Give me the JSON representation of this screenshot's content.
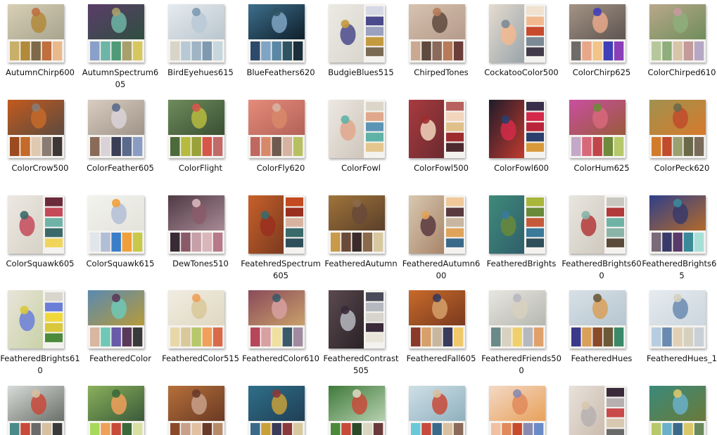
{
  "items": [
    {
      "name": "AutumnChirp600",
      "layout": "bottom",
      "colors": [
        "#c8b06a",
        "#b18a3a",
        "#7e6a4b",
        "#c06f3f",
        "#e9b98c"
      ],
      "bg": [
        "#d8cfb5",
        "#a8a48f"
      ],
      "icon": "bird-icon"
    },
    {
      "name": "AutumnSpectrum605",
      "layout": "bottom",
      "colors": [
        "#8aa0c8",
        "#6db5a6",
        "#4f9b78",
        "#a8a06c",
        "#d6c85f"
      ],
      "bg": [
        "#5b3d6a",
        "#2f4f3f"
      ],
      "icon": "leaf-icon"
    },
    {
      "name": "BirdEyehues615",
      "layout": "bottom",
      "colors": [
        "#d8d4c8",
        "#b8c9d6",
        "#9fb4c4",
        "#7e9ab0",
        "#c6d7de"
      ],
      "bg": [
        "#e6ebee",
        "#b9c6cf"
      ],
      "icon": "eye-icon"
    },
    {
      "name": "BlueFeathers620",
      "layout": "bottom",
      "colors": [
        "#2e4a6b",
        "#7fa4c4",
        "#5a88a4",
        "#2e5464",
        "#1b2f3a"
      ],
      "bg": [
        "#3d6f8c",
        "#0f1f2b"
      ],
      "icon": "feather-icon"
    },
    {
      "name": "BudgieBlues515",
      "layout": "right",
      "colors": [
        "#d6d9e4",
        "#4b4a8c",
        "#9aa0bd",
        "#c39a3f",
        "#7a6a54"
      ],
      "bg": [
        "#eceae3",
        "#d8d6cd"
      ],
      "icon": "bird-icon"
    },
    {
      "name": "ChirpedTones",
      "layout": "bottom",
      "colors": [
        "#caa891",
        "#5f4a3f",
        "#8a6a5b",
        "#b77b59",
        "#6b3e3a"
      ],
      "bg": [
        "#d7c2b0",
        "#b59a8a"
      ],
      "icon": "bird-icon"
    },
    {
      "name": "CockatooColor500",
      "layout": "right",
      "colors": [
        "#f0e2cf",
        "#f2b98f",
        "#c84a2c",
        "#7c8a96",
        "#433b4a"
      ],
      "bg": [
        "#e5dccf",
        "#9aa4aa"
      ],
      "icon": "bird-icon"
    },
    {
      "name": "ColorChirp625",
      "layout": "bottom",
      "colors": [
        "#6f6b68",
        "#e7a88a",
        "#f2c487",
        "#3f3fb8",
        "#8a3fb8"
      ],
      "bg": [
        "#a49486",
        "#5e5550"
      ],
      "icon": "bird-icon"
    },
    {
      "name": "ColorChirped610",
      "layout": "bottom",
      "colors": [
        "#b6c89b",
        "#8eae7b",
        "#d8c4a8",
        "#c49a9a",
        "#b6a8c4"
      ],
      "bg": [
        "#b9a88b",
        "#6f8d5a"
      ],
      "icon": "bird-icon"
    },
    {
      "name": "ColorCrow500",
      "layout": "bottom",
      "colors": [
        "#9c4a1f",
        "#c46a2a",
        "#e0c9b1",
        "#8a7b73",
        "#3e3535"
      ],
      "bg": [
        "#c25a1e",
        "#5d4a3f"
      ],
      "icon": "bird-icon"
    },
    {
      "name": "ColorFeather605",
      "layout": "bottom",
      "colors": [
        "#8a6a58",
        "#d9d3d8",
        "#3a3f55",
        "#5a6a8c",
        "#8a9cc4"
      ],
      "bg": [
        "#d8cdc0",
        "#a09388"
      ],
      "icon": "feather-icon"
    },
    {
      "name": "ColorFlight",
      "layout": "bottom",
      "colors": [
        "#4d6a3a",
        "#b6bb3f",
        "#9aa03a",
        "#d6564a",
        "#c06a6a"
      ],
      "bg": [
        "#6e8c5c",
        "#3a4f33"
      ],
      "icon": "bird-icon"
    },
    {
      "name": "ColorFly620",
      "layout": "bottom",
      "colors": [
        "#c0675f",
        "#d8886a",
        "#6f5a4f",
        "#d6b3a0",
        "#b6c062"
      ],
      "bg": [
        "#e58b7a",
        "#b36258"
      ],
      "icon": "bird-icon"
    },
    {
      "name": "ColorFowl",
      "layout": "right",
      "colors": [
        "#dbd6c8",
        "#e0a78c",
        "#5c94b6",
        "#5fb3a6",
        "#e4c68e"
      ],
      "bg": [
        "#ece8e2",
        "#cfc6bb"
      ],
      "icon": "bird-icon"
    },
    {
      "name": "ColorFowl500",
      "layout": "right",
      "colors": [
        "#b7625e",
        "#f1d5bd",
        "#e0c08a",
        "#9e2c2f",
        "#4d2a2f"
      ],
      "bg": [
        "#a83a3f",
        "#6b2b30"
      ],
      "icon": "bird-icon"
    },
    {
      "name": "ColorFowl600",
      "layout": "right",
      "colors": [
        "#3a2f4a",
        "#d42a4a",
        "#b9243a",
        "#2a3f6b",
        "#d99a3a"
      ],
      "bg": [
        "#1f1c2a",
        "#c13a2f"
      ],
      "icon": "bird-icon"
    },
    {
      "name": "ColorHum625",
      "layout": "bottom",
      "colors": [
        "#c4a8c8",
        "#d7687a",
        "#c1464a",
        "#6e8a3a",
        "#b6c86a"
      ],
      "bg": [
        "#c94fa0",
        "#9a5a3a"
      ],
      "icon": "bird-icon"
    },
    {
      "name": "ColorPeck620",
      "layout": "bottom",
      "colors": [
        "#d27b2b",
        "#c14b2b",
        "#9aa06f",
        "#6a6a4a",
        "#7a6a5a"
      ],
      "bg": [
        "#a0914f",
        "#d67a2b"
      ],
      "icon": "bird-icon"
    },
    {
      "name": "ColorSquawk605",
      "layout": "right",
      "colors": [
        "#6b2b3a",
        "#c44a5a",
        "#6fb3a8",
        "#3a6a6a",
        "#f0d55a"
      ],
      "bg": [
        "#ece8e2",
        "#d7d2c6"
      ],
      "icon": "bird-icon"
    },
    {
      "name": "ColorSquawk615",
      "layout": "bottom",
      "colors": [
        "#e1e6ea",
        "#b2bed6",
        "#3a7ec8",
        "#f0a03a",
        "#c8c84a"
      ],
      "bg": [
        "#f3f3ef",
        "#e3e3da"
      ],
      "icon": "bird-icon"
    },
    {
      "name": "DewTones510",
      "layout": "bottom",
      "colors": [
        "#3a2a35",
        "#8a5a6a",
        "#c6a0a8",
        "#d9b6ba",
        "#b67a8a"
      ],
      "bg": [
        "#4f3a44",
        "#a88a96"
      ],
      "icon": "leaf-icon"
    },
    {
      "name": "FeatehredSpectrum605",
      "layout": "right",
      "colors": [
        "#c44a1f",
        "#9a2f1f",
        "#d8b3a0",
        "#3a6a6a",
        "#2f4f5a"
      ],
      "bg": [
        "#c8602a",
        "#7a3a1f"
      ],
      "icon": "feather-icon"
    },
    {
      "name": "FeatheredAutumn",
      "layout": "bottom",
      "colors": [
        "#c89a4a",
        "#6a4a3a",
        "#3a2a2a",
        "#8a6a4a",
        "#d8c8a0"
      ],
      "bg": [
        "#a0743a",
        "#5a3f2a"
      ],
      "icon": "feather-icon"
    },
    {
      "name": "FeatheredAutumn600",
      "layout": "right",
      "colors": [
        "#f0c89a",
        "#5a3a3f",
        "#c8b6a0",
        "#e0a35a",
        "#3a6a8a"
      ],
      "bg": [
        "#d8c8b0",
        "#a8856a"
      ],
      "icon": "bird-icon"
    },
    {
      "name": "FeatheredBrights",
      "layout": "right",
      "colors": [
        "#a8b63a",
        "#6a8a3a",
        "#c45a3a",
        "#3a7a9a",
        "#2f4f5a"
      ],
      "bg": [
        "#3f8a7a",
        "#2f5f6a"
      ],
      "icon": "feather-icon"
    },
    {
      "name": "FeatheredBrights600",
      "layout": "right",
      "colors": [
        "#c8c8c0",
        "#b33a3a",
        "#6fb3a6",
        "#8ab4a8",
        "#5a4a3a"
      ],
      "bg": [
        "#e8e6e0",
        "#cfc9be"
      ],
      "icon": "bird-icon"
    },
    {
      "name": "FeatheredBrights605",
      "layout": "bottom",
      "colors": [
        "#7a6a7a",
        "#3a3a6a",
        "#5a3a6a",
        "#3a8a9a",
        "#a8e0d8"
      ],
      "bg": [
        "#2f3f8a",
        "#b36a2a"
      ],
      "icon": "feather-icon"
    },
    {
      "name": "FeatheredBrights610",
      "layout": "right",
      "colors": [
        "#d8d6cc",
        "#6a7ed8",
        "#f0d83a",
        "#d8c83a",
        "#4a8a3a"
      ],
      "bg": [
        "#e8e4da",
        "#c9d2a6"
      ],
      "icon": "bird-icon"
    },
    {
      "name": "FeatheredColor",
      "layout": "bottom",
      "colors": [
        "#d8b6a0",
        "#6fc8b6",
        "#6a5aa8",
        "#5a3a5a",
        "#3a3a3a"
      ],
      "bg": [
        "#5a8ab0",
        "#b69a3a"
      ],
      "icon": "feather-icon"
    },
    {
      "name": "FeatheredColor515",
      "layout": "bottom",
      "colors": [
        "#e8d8a8",
        "#d8c89a",
        "#b6c86a",
        "#f0a05a",
        "#d86a4a"
      ],
      "bg": [
        "#f0ece2",
        "#e0d8c0"
      ],
      "icon": "bird-icon"
    },
    {
      "name": "FeatheredColor610",
      "layout": "bottom",
      "colors": [
        "#b6465a",
        "#d8a0a0",
        "#f0e0a0",
        "#3a5a6a",
        "#a08aa0"
      ],
      "bg": [
        "#8a4a5a",
        "#c9a06a"
      ],
      "icon": "feather-icon"
    },
    {
      "name": "FeatheredContrast505",
      "layout": "right",
      "colors": [
        "#4a4a5a",
        "#b6b8c0",
        "#d6d4cc",
        "#3a2a3a",
        "#e8e4da"
      ],
      "bg": [
        "#5a4a50",
        "#2a2226"
      ],
      "icon": "feather-icon"
    },
    {
      "name": "FeatheredFall605",
      "layout": "bottom",
      "colors": [
        "#8a3a2a",
        "#d6a06a",
        "#c8b6a0",
        "#3a3a5a",
        "#f0c86a"
      ],
      "bg": [
        "#c86a2a",
        "#7a3a1f"
      ],
      "icon": "feather-icon"
    },
    {
      "name": "FeatheredFriends500",
      "layout": "bottom",
      "colors": [
        "#6a8a8a",
        "#d8d0c0",
        "#f0d06a",
        "#b6b8c0",
        "#e0a06a"
      ],
      "bg": [
        "#e8e6e0",
        "#b6b8b0"
      ],
      "icon": "bird-icon"
    },
    {
      "name": "FeatheredHues",
      "layout": "bottom",
      "colors": [
        "#3a3a8a",
        "#d8a05a",
        "#8a4a2a",
        "#6a5a3a",
        "#3a8a6a"
      ],
      "bg": [
        "#d8e0e6",
        "#b6c6d0"
      ],
      "icon": "bird-icon"
    },
    {
      "name": "FeatheredHues_1",
      "layout": "bottom",
      "colors": [
        "#b6cce0",
        "#6a8ab0",
        "#e0d0b6",
        "#d6d0c0",
        "#c8d0d8"
      ],
      "bg": [
        "#e6ebef",
        "#cbd6de"
      ],
      "icon": "bird-icon"
    },
    {
      "name": "",
      "layout": "bottom",
      "colors": [
        "#4a8a8a",
        "#c84a3a",
        "#6a6a6a",
        "#d6c0a0",
        "#3a3a3a"
      ],
      "bg": [
        "#d8dcd8",
        "#6a6f6a"
      ],
      "icon": "bird-icon"
    },
    {
      "name": "",
      "layout": "bottom",
      "colors": [
        "#a8d85a",
        "#f0a05a",
        "#c84a3a",
        "#3a6a3a",
        "#d8e0a0"
      ],
      "bg": [
        "#8ab05a",
        "#3a5a3a"
      ],
      "icon": "bird-icon"
    },
    {
      "name": "",
      "layout": "bottom",
      "colors": [
        "#8a4a2a",
        "#c8a08a",
        "#e0c0a0",
        "#6a3a2a",
        "#b68a6a"
      ],
      "bg": [
        "#b6703a",
        "#6a3a24"
      ],
      "icon": "feather-icon"
    },
    {
      "name": "",
      "layout": "bottom",
      "colors": [
        "#3a6a8a",
        "#c8a03a",
        "#3a3a5a",
        "#8a3a3a",
        "#d8c8a0"
      ],
      "bg": [
        "#2f6f8a",
        "#1f3f55"
      ],
      "icon": "feather-icon"
    },
    {
      "name": "",
      "layout": "bottom",
      "colors": [
        "#4a8a3a",
        "#c84a3a",
        "#2a4a2a",
        "#d8d8c0",
        "#6a3a3a"
      ],
      "bg": [
        "#3f7a3a",
        "#b6d0b0"
      ],
      "icon": "bird-icon"
    },
    {
      "name": "",
      "layout": "bottom",
      "colors": [
        "#6ac8d8",
        "#c84a3a",
        "#3a6a8a",
        "#d8c0a0",
        "#8a6a5a"
      ],
      "bg": [
        "#cfe0e6",
        "#8fb0bf"
      ],
      "icon": "bird-icon"
    },
    {
      "name": "",
      "layout": "bottom",
      "colors": [
        "#f0c0a0",
        "#e08a5a",
        "#c84a2a",
        "#8a8ab0",
        "#6a8ac8"
      ],
      "bg": [
        "#f3d9c6",
        "#e8a15a"
      ],
      "icon": "bird-icon"
    },
    {
      "name": "",
      "layout": "right",
      "colors": [
        "#3a2a3a",
        "#b6b0b0",
        "#c84a4a",
        "#d8c8b0",
        "#6a6a6a"
      ],
      "bg": [
        "#e8e2da",
        "#c8b8aa"
      ],
      "icon": "feather-icon"
    },
    {
      "name": "",
      "layout": "bottom",
      "colors": [
        "#b6c86a",
        "#6ab0c8",
        "#3a6a8a",
        "#d8c86a",
        "#6a8a5a"
      ],
      "bg": [
        "#3a8a7a",
        "#6a7a3a"
      ],
      "icon": "feather-icon"
    }
  ]
}
